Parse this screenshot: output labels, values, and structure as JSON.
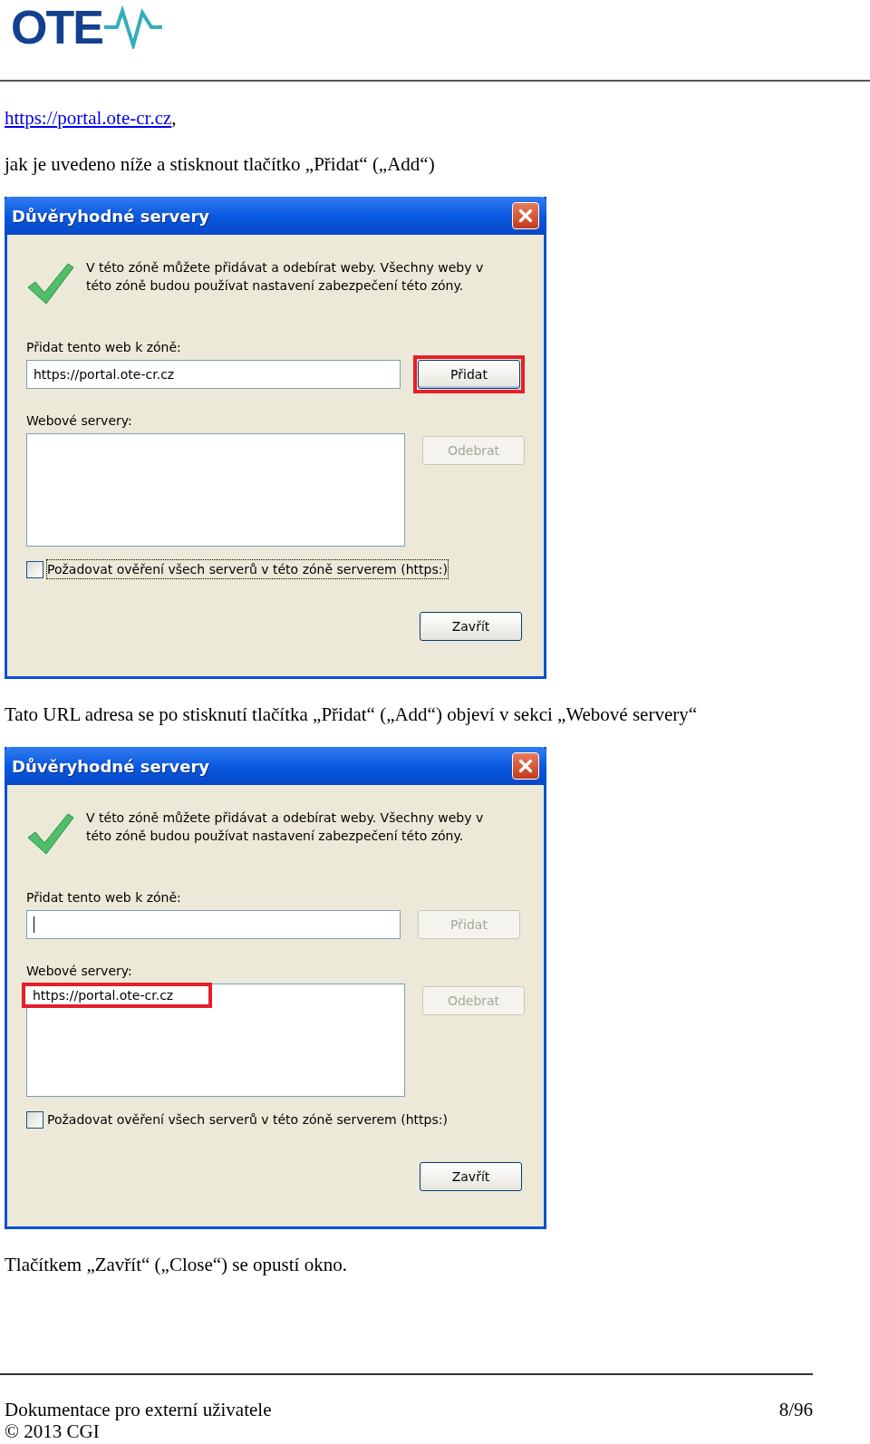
{
  "header": {
    "logo": "OTE"
  },
  "content": [
    {
      "kind": "link_line",
      "link": "https://portal.ote-cr.cz",
      "suffix": ","
    },
    {
      "kind": "text",
      "text": "jak je uvedeno níže a stisknout tlačítko „Přidat“ („Add“)"
    },
    {
      "kind": "dialog",
      "title": "Důvěryhodné servery",
      "message": "V této zóně můžete přidávat a odebírat weby. Všechny weby v této zóně budou používat nastavení zabezpečení této zóny.",
      "add_label": "Přidat tento web k zóně:",
      "url_field": {
        "value": "https://portal.ote-cr.cz",
        "focused": false
      },
      "add_button": {
        "label": "Přidat",
        "disabled": false,
        "highlighted": true
      },
      "servers_label": "Webové servery:",
      "remove_button": {
        "label": "Odebrat",
        "disabled": true
      },
      "https_checkbox": {
        "label": "Požadovat ověření všech serverů v této zóně serverem (https:)",
        "checked": false,
        "focused": true
      },
      "close_button": {
        "label": "Zavřít"
      }
    },
    {
      "kind": "text",
      "text": "Tato URL adresa se po stisknutí tlačítka „Přidat“ („Add“) objeví v sekci „Webové servery“"
    },
    {
      "kind": "dialog",
      "title": "Důvěryhodné servery",
      "message": "V této zóně můžete přidávat a odebírat weby. Všechny weby v této zóně budou používat nastavení zabezpečení této zóny.",
      "add_label": "Přidat tento web k zóně:",
      "url_field": {
        "focused": true
      },
      "add_button": {
        "label": "Přidat",
        "disabled": true,
        "highlighted": false
      },
      "servers_label": "Webové servery:",
      "servers": [
        {
          "text": "https://portal.ote-cr.cz",
          "highlighted": true
        }
      ],
      "remove_button": {
        "label": "Odebrat",
        "disabled": true
      },
      "https_checkbox": {
        "label": "Požadovat ověření všech serverů v této zóně serverem (https:)",
        "checked": false,
        "focused": false
      },
      "close_button": {
        "label": "Zavřít"
      }
    },
    {
      "kind": "text",
      "text": "Tlačítkem „Zavřít“ („Close“) se opustí okno."
    }
  ],
  "footer": {
    "title": "Dokumentace pro externí uživatele",
    "page": "8/96",
    "copyright": "© 2013 CGI"
  }
}
